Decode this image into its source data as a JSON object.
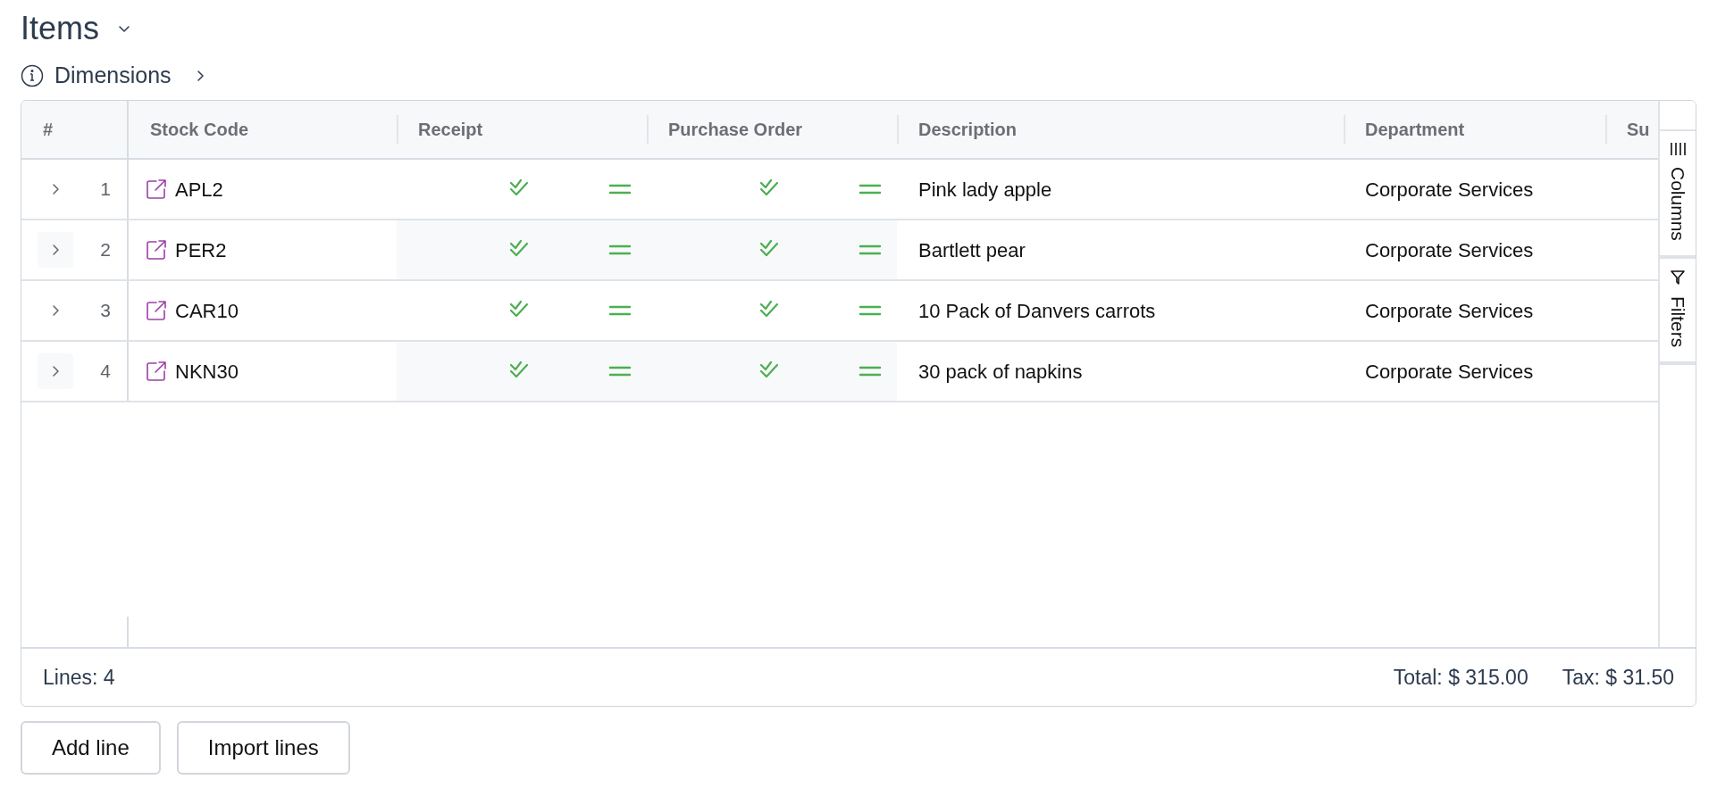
{
  "title": "Items",
  "dimensions_link": "Dimensions",
  "table": {
    "columns": [
      {
        "label": "#"
      },
      {
        "label": "Stock Code"
      },
      {
        "label": "Receipt"
      },
      {
        "label": "Purchase Order"
      },
      {
        "label": "Description"
      },
      {
        "label": "Department"
      },
      {
        "label": "Su"
      }
    ],
    "rows": [
      {
        "number": "1",
        "stock_code": "APL2",
        "description": "Pink lady apple",
        "department": "Corporate Services"
      },
      {
        "number": "2",
        "stock_code": "PER2",
        "description": "Bartlett pear",
        "department": "Corporate Services"
      },
      {
        "number": "3",
        "stock_code": "CAR10",
        "description": "10 Pack of Danvers carrots",
        "department": "Corporate Services"
      },
      {
        "number": "4",
        "stock_code": "NKN30",
        "description": "30 pack of napkins",
        "department": "Corporate Services"
      }
    ]
  },
  "side_tabs": [
    {
      "label": "Columns",
      "kind": "columns"
    },
    {
      "label": "Filters",
      "kind": "filters"
    }
  ],
  "footer": {
    "lines": "Lines: 4",
    "total": "Total: $ 315.00",
    "tax": "Tax: $ 31.50"
  },
  "buttons": [
    "Add line",
    "Import lines"
  ]
}
